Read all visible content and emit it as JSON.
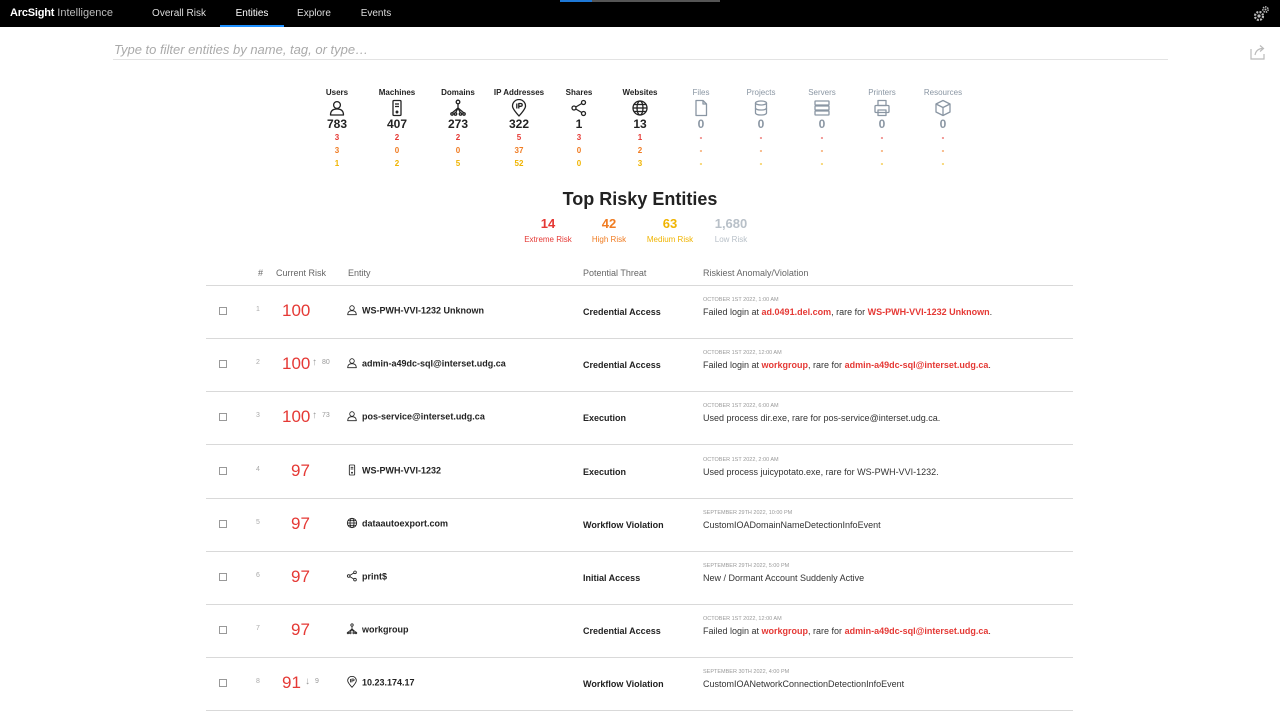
{
  "app": {
    "brand_bold": "ArcSight",
    "brand_light": " Intelligence"
  },
  "nav": [
    "Overall Risk",
    "Entities",
    "Explore",
    "Events"
  ],
  "active_tab": "Entities",
  "loading_progress": 0.2,
  "filter": {
    "placeholder": "Type to filter entities by name, tag, or type…",
    "value": ""
  },
  "colors": {
    "extreme": "#e53935",
    "high": "#f07c22",
    "medium": "#f0b400",
    "low": "#b8c0c8",
    "accent": "#1e90ff"
  },
  "entity_types": [
    {
      "label": "Users",
      "icon": "user-icon",
      "count": "783",
      "extreme": "3",
      "high": "3",
      "medium": "1",
      "dim": false
    },
    {
      "label": "Machines",
      "icon": "machine-icon",
      "count": "407",
      "extreme": "2",
      "high": "0",
      "medium": "2",
      "dim": false
    },
    {
      "label": "Domains",
      "icon": "domain-icon",
      "count": "273",
      "extreme": "2",
      "high": "0",
      "medium": "5",
      "dim": false
    },
    {
      "label": "IP Addresses",
      "icon": "ip-address-icon",
      "count": "322",
      "extreme": "5",
      "high": "37",
      "medium": "52",
      "dim": false
    },
    {
      "label": "Shares",
      "icon": "share-icon",
      "count": "1",
      "extreme": "3",
      "high": "0",
      "medium": "0",
      "dim": false
    },
    {
      "label": "Websites",
      "icon": "globe-icon",
      "count": "13",
      "extreme": "1",
      "high": "2",
      "medium": "3",
      "dim": false
    },
    {
      "label": "Files",
      "icon": "file-icon",
      "count": "0",
      "extreme": "-",
      "high": "-",
      "medium": "-",
      "dim": true
    },
    {
      "label": "Projects",
      "icon": "database-icon",
      "count": "0",
      "extreme": "-",
      "high": "-",
      "medium": "-",
      "dim": true
    },
    {
      "label": "Servers",
      "icon": "server-icon",
      "count": "0",
      "extreme": "-",
      "high": "-",
      "medium": "-",
      "dim": true
    },
    {
      "label": "Printers",
      "icon": "printer-icon",
      "count": "0",
      "extreme": "-",
      "high": "-",
      "medium": "-",
      "dim": true
    },
    {
      "label": "Resources",
      "icon": "cube-icon",
      "count": "0",
      "extreme": "-",
      "high": "-",
      "medium": "-",
      "dim": true
    }
  ],
  "top_risky": {
    "title": "Top Risky Entities",
    "summary": [
      {
        "value": "14",
        "label": "Extreme Risk",
        "level": "ext"
      },
      {
        "value": "42",
        "label": "High Risk",
        "level": "high"
      },
      {
        "value": "63",
        "label": "Medium Risk",
        "level": "med"
      },
      {
        "value": "1,680",
        "label": "Low Risk",
        "level": "low"
      }
    ]
  },
  "table": {
    "columns": {
      "num": "#",
      "risk": "Current Risk",
      "entity": "Entity",
      "threat": "Potential Threat",
      "anomaly": "Riskiest Anomaly/Violation"
    },
    "rows": [
      {
        "num": "1",
        "score": "100",
        "arrow": "",
        "delta": "",
        "icon": "user-icon",
        "entity": "WS-PWH-VVI-1232 Unknown",
        "threat": "Credential Access",
        "date": "OCTOBER 1ST 2022, 1:00 AM",
        "desc": [
          {
            "t": "Failed login at ",
            "h": false
          },
          {
            "t": "ad.0491.del.com",
            "h": true
          },
          {
            "t": ", rare for ",
            "h": false
          },
          {
            "t": "WS-PWH-VVI-1232 Unknown",
            "h": true
          },
          {
            "t": ".",
            "h": false
          }
        ]
      },
      {
        "num": "2",
        "score": "100",
        "arrow": "↑",
        "delta": "80",
        "icon": "user-icon",
        "entity": "admin-a49dc-sql@interset.udg.ca",
        "threat": "Credential Access",
        "date": "OCTOBER 1ST 2022, 12:00 AM",
        "desc": [
          {
            "t": "Failed login at ",
            "h": false
          },
          {
            "t": "workgroup",
            "h": true
          },
          {
            "t": ", rare for ",
            "h": false
          },
          {
            "t": "admin-a49dc-sql@interset.udg.ca",
            "h": true
          },
          {
            "t": ".",
            "h": false
          }
        ]
      },
      {
        "num": "3",
        "score": "100",
        "arrow": "↑",
        "delta": "73",
        "icon": "user-icon",
        "entity": "pos-service@interset.udg.ca",
        "threat": "Execution",
        "date": "OCTOBER 1ST 2022, 6:00 AM",
        "desc": [
          {
            "t": "Used process dir.exe, rare for pos-service@interset.udg.ca.",
            "h": false
          }
        ]
      },
      {
        "num": "4",
        "score": "97",
        "arrow": "",
        "delta": "",
        "icon": "machine-icon",
        "entity": "WS-PWH-VVI-1232",
        "threat": "Execution",
        "date": "OCTOBER 1ST 2022, 2:00 AM",
        "desc": [
          {
            "t": "Used process juicypotato.exe, rare for WS-PWH-VVI-1232.",
            "h": false
          }
        ]
      },
      {
        "num": "5",
        "score": "97",
        "arrow": "",
        "delta": "",
        "icon": "globe-icon",
        "entity": "dataautoexport.com",
        "threat": "Workflow Violation",
        "date": "SEPTEMBER 29TH 2022, 10:00 PM",
        "desc": [
          {
            "t": "CustomIOADomainNameDetectionInfoEvent",
            "h": false
          }
        ]
      },
      {
        "num": "6",
        "score": "97",
        "arrow": "",
        "delta": "",
        "icon": "share-icon",
        "entity": "print$",
        "threat": "Initial Access",
        "date": "SEPTEMBER 29TH 2022, 5:00 PM",
        "desc": [
          {
            "t": "New / Dormant Account Suddenly Active",
            "h": false
          }
        ]
      },
      {
        "num": "7",
        "score": "97",
        "arrow": "",
        "delta": "",
        "icon": "domain-icon",
        "entity": "workgroup",
        "threat": "Credential Access",
        "date": "OCTOBER 1ST 2022, 12:00 AM",
        "desc": [
          {
            "t": "Failed login at ",
            "h": false
          },
          {
            "t": "workgroup",
            "h": true
          },
          {
            "t": ", rare for ",
            "h": false
          },
          {
            "t": "admin-a49dc-sql@interset.udg.ca",
            "h": true
          },
          {
            "t": ".",
            "h": false
          }
        ]
      },
      {
        "num": "8",
        "score": "91",
        "arrow": "↓",
        "delta": "9",
        "icon": "ip-address-icon",
        "entity": "10.23.174.17",
        "threat": "Workflow Violation",
        "date": "SEPTEMBER 30TH 2022, 4:00 PM",
        "desc": [
          {
            "t": "CustomIOANetworkConnectionDetectionInfoEvent",
            "h": false
          }
        ]
      }
    ]
  }
}
